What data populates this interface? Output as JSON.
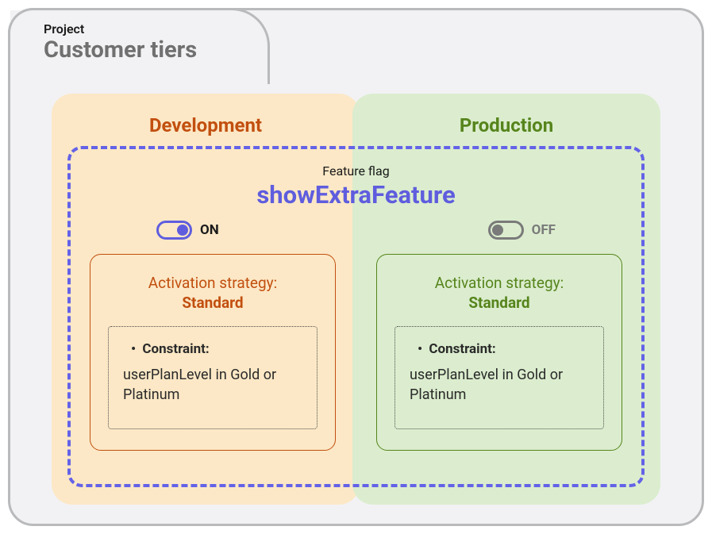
{
  "project": {
    "label": "Project",
    "name": "Customer tiers"
  },
  "environments": {
    "development": {
      "title": "Development",
      "toggle": {
        "state": "on",
        "label": "ON"
      },
      "strategy": {
        "title": "Activation strategy:",
        "value": "Standard",
        "constraint": {
          "label": "Constraint:",
          "text": "userPlanLevel in Gold or Platinum"
        }
      }
    },
    "production": {
      "title": "Production",
      "toggle": {
        "state": "off",
        "label": "OFF"
      },
      "strategy": {
        "title": "Activation strategy:",
        "value": "Standard",
        "constraint": {
          "label": "Constraint:",
          "text": "userPlanLevel in Gold or Platinum"
        }
      }
    }
  },
  "featureFlag": {
    "label": "Feature flag",
    "name": "showExtraFeature"
  }
}
